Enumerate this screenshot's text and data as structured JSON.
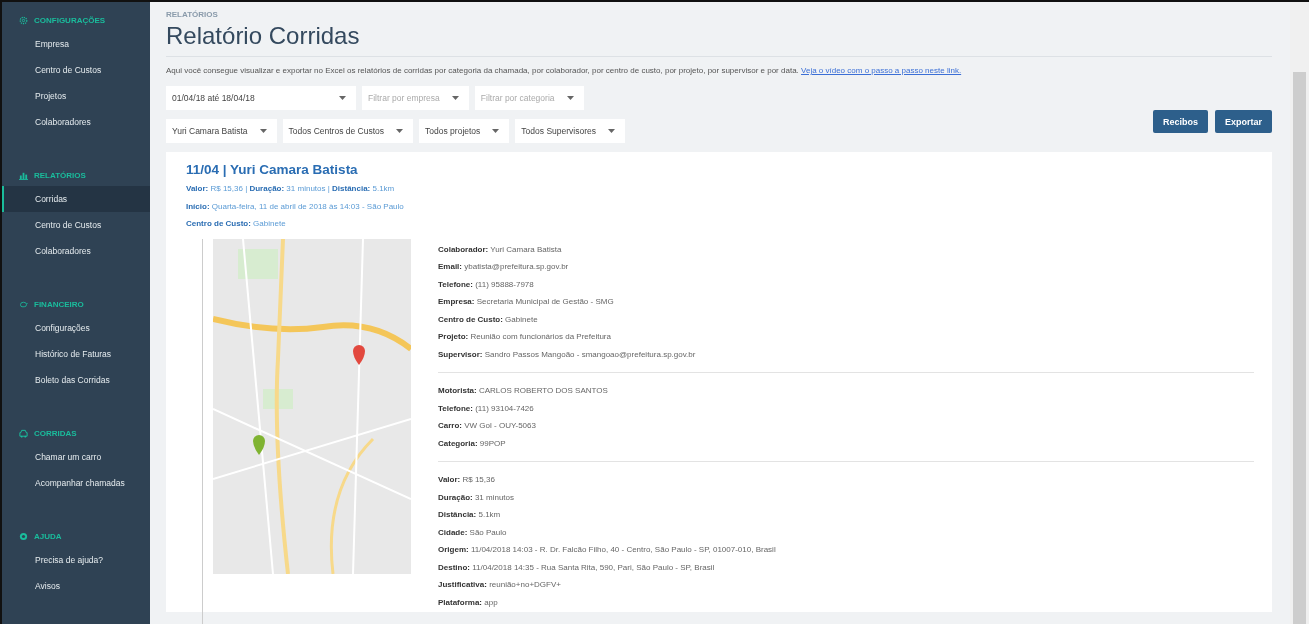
{
  "sidebar": {
    "sections": [
      {
        "kind": "gear",
        "title": "CONFIGURAÇÕES",
        "items": [
          {
            "label": "Empresa",
            "selected": false
          },
          {
            "label": "Centro de Custos",
            "selected": false
          },
          {
            "label": "Projetos",
            "selected": false
          },
          {
            "label": "Colaboradores",
            "selected": false
          }
        ]
      },
      {
        "kind": "report",
        "title": "RELATÓRIOS",
        "items": [
          {
            "label": "Corridas",
            "selected": true
          },
          {
            "label": "Centro de Custos",
            "selected": false
          },
          {
            "label": "Colaboradores",
            "selected": false
          }
        ]
      },
      {
        "kind": "piggy",
        "title": "FINANCEIRO",
        "items": [
          {
            "label": "Configurações",
            "selected": false
          },
          {
            "label": "Histórico de Faturas",
            "selected": false
          },
          {
            "label": "Boleto das Corridas",
            "selected": false
          }
        ]
      },
      {
        "kind": "car",
        "title": "CORRIDAS",
        "items": [
          {
            "label": "Chamar um carro",
            "selected": false
          },
          {
            "label": "Acompanhar chamadas",
            "selected": false
          }
        ]
      },
      {
        "kind": "help",
        "title": "AJUDA",
        "items": [
          {
            "label": "Precisa de ajuda?",
            "selected": false
          },
          {
            "label": "Avisos",
            "selected": false
          }
        ]
      }
    ]
  },
  "header": {
    "breadcrumb": "RELATÓRIOS",
    "title": "Relatório Corridas",
    "description": "Aqui você consegue visualizar e exportar no Excel os relatórios de corridas por categoria da chamada, por colaborador, por centro de custo, por projeto, por supervisor e por data.",
    "link": "Veja o vídeo com o passo a passo neste link."
  },
  "filters": [
    [
      {
        "value": "01/04/18 até 18/04/18"
      },
      {
        "placeholder": "Filtrar por empresa"
      },
      {
        "placeholder": "Filtrar por categoria"
      }
    ],
    [
      {
        "value": "Yuri Camara Batista"
      },
      {
        "value": "Todos Centros de Custos"
      },
      {
        "value": "Todos projetos"
      },
      {
        "value": "Todos Supervisores"
      }
    ]
  ],
  "buttons": [
    "Recibos",
    "Exportar"
  ],
  "ride": {
    "title": "11/04 | Yuri Camara Batista",
    "summary": [
      "**Valor:** R$ 15,36 | **Duração:** 31 minutos | **Distância:** 5.1km",
      "**Início:** Quarta-feira, 11 de abril de 2018 às 14:03 - São Paulo",
      "**Centro de Custo:** Gabinete"
    ],
    "details": [
      [
        "**Colaborador:** Yuri Camara Batista",
        "**Email:** ybatista@prefeitura.sp.gov.br",
        "**Telefone:** (11) 95888-7978",
        "**Empresa:** Secretaria Municipal de Gestão - SMG",
        "**Centro de Custo:** Gabinete",
        "**Projeto:** Reunião com funcionários da Prefeitura",
        "**Supervisor:** Sandro Passos Mangoão - smangoao@prefeitura.sp.gov.br"
      ],
      [
        "**Motorista:** CARLOS ROBERTO DOS SANTOS",
        "**Telefone:** (11) 93104-7426",
        "**Carro:** VW Gol - OUY-5063",
        "**Categoria:** 99POP"
      ],
      [
        "**Valor:** R$ 15,36",
        "**Duração:** 31 minutos",
        "**Distância:** 5.1km",
        "**Cidade:** São Paulo",
        "**Origem:** 11/04/2018 14:03 - R. Dr. Falcão Filho, 40 - Centro, São Paulo - SP, 01007-010, Brasil",
        "**Destino:** 11/04/2018 14:35 - Rua Santa Rita, 590, Pari, São Paulo - SP, Brasil",
        "**Justificativa:** reunião+no+DGFV+",
        "**Plataforma:** app"
      ]
    ]
  }
}
